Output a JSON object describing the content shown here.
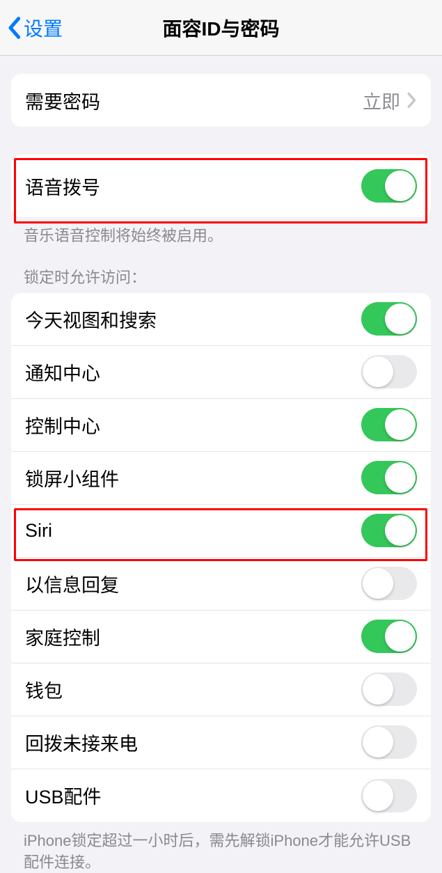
{
  "header": {
    "back_label": "设置",
    "title": "面容ID与密码"
  },
  "require_passcode": {
    "label": "需要密码",
    "value": "立即"
  },
  "voice_dial": {
    "label": "语音拨号",
    "on": true,
    "footer": "音乐语音控制将始终被启用。"
  },
  "locked_section_header": "锁定时允许访问：",
  "locked_items": [
    {
      "label": "今天视图和搜索",
      "on": true
    },
    {
      "label": "通知中心",
      "on": false
    },
    {
      "label": "控制中心",
      "on": true
    },
    {
      "label": "锁屏小组件",
      "on": true
    },
    {
      "label": "Siri",
      "on": true
    },
    {
      "label": "以信息回复",
      "on": false
    },
    {
      "label": "家庭控制",
      "on": true
    },
    {
      "label": "钱包",
      "on": false
    },
    {
      "label": "回拨未接来电",
      "on": false
    },
    {
      "label": "USB配件",
      "on": false
    }
  ],
  "usb_footer": "iPhone锁定超过一小时后，需先解锁iPhone才能允许USB配件连接。"
}
